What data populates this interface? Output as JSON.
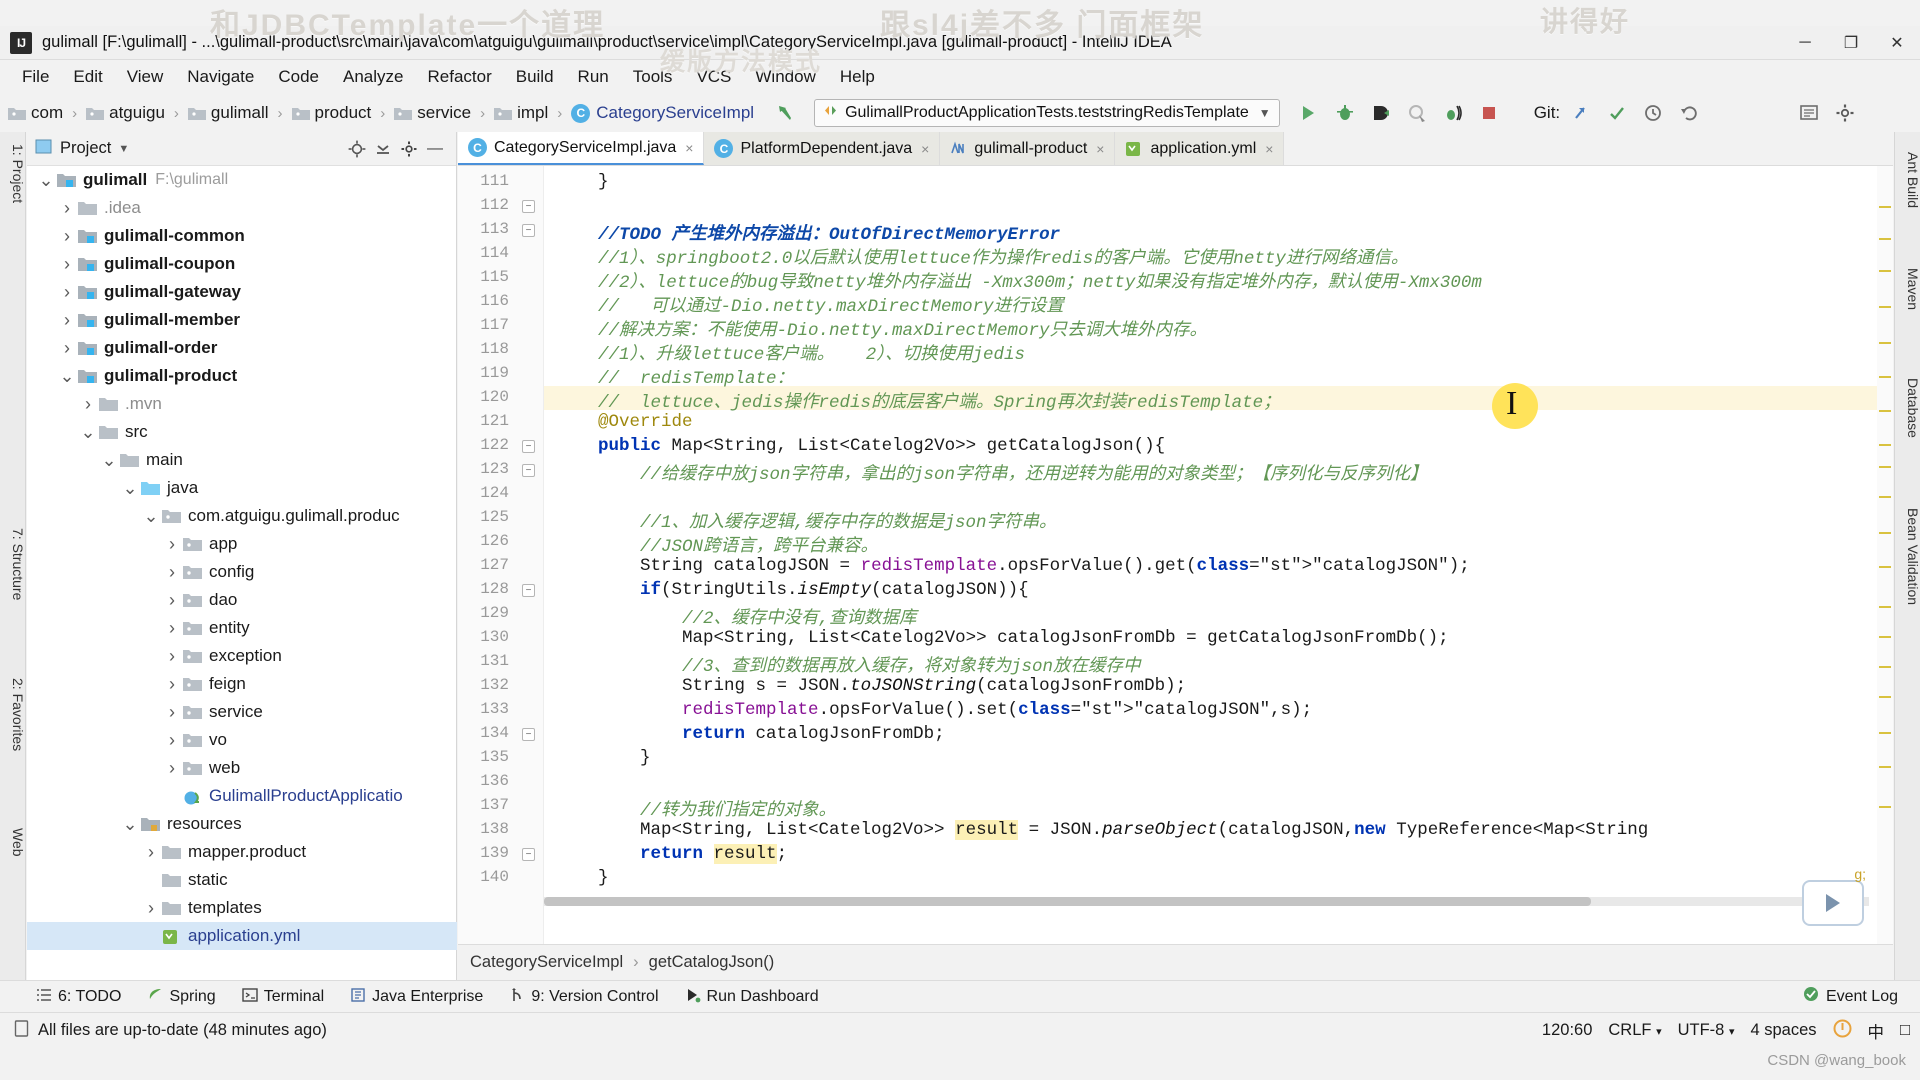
{
  "watermarks": [
    "和JDBCTemplate一个道理",
    "跟sl4j差不多  门面框架",
    "讲得好",
    "缓版方法模式"
  ],
  "window": {
    "logo": "IJ",
    "title": "gulimall [F:\\gulimall] - ...\\gulimall-product\\src\\main\\java\\com\\atguigu\\gulimall\\product\\service\\impl\\CategoryServiceImpl.java [gulimall-product] - IntelliJ IDEA",
    "minimize": "─",
    "maximize": "❐",
    "close": "✕"
  },
  "menubar": [
    "File",
    "Edit",
    "View",
    "Navigate",
    "Code",
    "Analyze",
    "Refactor",
    "Build",
    "Run",
    "Tools",
    "VCS",
    "Window",
    "Help"
  ],
  "breadcrumb": [
    {
      "label": "com",
      "icon": "folder-icon"
    },
    {
      "label": "atguigu",
      "icon": "folder-icon"
    },
    {
      "label": "gulimall",
      "icon": "folder-icon"
    },
    {
      "label": "product",
      "icon": "folder-icon"
    },
    {
      "label": "service",
      "icon": "folder-icon"
    },
    {
      "label": "impl",
      "icon": "folder-icon"
    },
    {
      "label": "CategoryServiceImpl",
      "icon": "class-icon"
    }
  ],
  "toolbar": {
    "back_icon": "back-arrow-icon",
    "run_config": "GulimallProductApplicationTests.teststringRedisTemplate",
    "dropdown_icon": "chevron-down-icon",
    "run_icon": "run-icon",
    "debug_icon": "debug-icon",
    "run_with_coverage_icon": "run-coverage-icon",
    "profile_icon": "profiler-icon",
    "stop_icon": "stop-icon",
    "git_label": "Git:",
    "git_update_icon": "update-project-icon",
    "git_commit_icon": "commit-icon",
    "git_history_icon": "history-icon",
    "git_rollback_icon": "rollback-icon",
    "search_everywhere_icon": "search-everywhere-icon",
    "settings_icon": "settings-icon"
  },
  "left_strip": [
    "1: Project",
    "7: Structure",
    "2: Favorites",
    "Web"
  ],
  "right_strip": [
    "Ant Build",
    "Maven",
    "Database",
    "Bean Validation"
  ],
  "project_panel": {
    "title": "Project",
    "panel_icon": "project-icon",
    "dropdown_icon": "chevron-down-icon",
    "locate_icon": "locate-icon",
    "collapse_icon": "collapse-all-icon",
    "settings_icon": "gear-icon",
    "hide_icon": "hide-icon",
    "tree": [
      {
        "label": "gulimall",
        "suffix": "F:\\gulimall",
        "indent": 0,
        "state": "open",
        "icon": "module-folder-icon",
        "bold": true
      },
      {
        "label": ".idea",
        "indent": 1,
        "state": "closed",
        "icon": "folder-icon",
        "dim": true
      },
      {
        "label": "gulimall-common",
        "indent": 1,
        "state": "closed",
        "icon": "module-folder-icon",
        "bold": true
      },
      {
        "label": "gulimall-coupon",
        "indent": 1,
        "state": "closed",
        "icon": "module-folder-icon",
        "bold": true
      },
      {
        "label": "gulimall-gateway",
        "indent": 1,
        "state": "closed",
        "icon": "module-folder-icon",
        "bold": true
      },
      {
        "label": "gulimall-member",
        "indent": 1,
        "state": "closed",
        "icon": "module-folder-icon",
        "bold": true
      },
      {
        "label": "gulimall-order",
        "indent": 1,
        "state": "closed",
        "icon": "module-folder-icon",
        "bold": true
      },
      {
        "label": "gulimall-product",
        "indent": 1,
        "state": "open",
        "icon": "module-folder-icon",
        "bold": true
      },
      {
        "label": ".mvn",
        "indent": 2,
        "state": "closed",
        "icon": "folder-icon",
        "dim": true
      },
      {
        "label": "src",
        "indent": 2,
        "state": "open",
        "icon": "folder-icon"
      },
      {
        "label": "main",
        "indent": 3,
        "state": "open",
        "icon": "folder-icon"
      },
      {
        "label": "java",
        "indent": 4,
        "state": "open",
        "icon": "source-folder-icon"
      },
      {
        "label": "com.atguigu.gulimall.produc",
        "indent": 5,
        "state": "open",
        "icon": "package-icon"
      },
      {
        "label": "app",
        "indent": 6,
        "state": "closed",
        "icon": "package-icon"
      },
      {
        "label": "config",
        "indent": 6,
        "state": "closed",
        "icon": "package-icon"
      },
      {
        "label": "dao",
        "indent": 6,
        "state": "closed",
        "icon": "package-icon"
      },
      {
        "label": "entity",
        "indent": 6,
        "state": "closed",
        "icon": "package-icon"
      },
      {
        "label": "exception",
        "indent": 6,
        "state": "closed",
        "icon": "package-icon"
      },
      {
        "label": "feign",
        "indent": 6,
        "state": "closed",
        "icon": "package-icon"
      },
      {
        "label": "service",
        "indent": 6,
        "state": "closed",
        "icon": "package-icon"
      },
      {
        "label": "vo",
        "indent": 6,
        "state": "closed",
        "icon": "package-icon"
      },
      {
        "label": "web",
        "indent": 6,
        "state": "closed",
        "icon": "package-icon"
      },
      {
        "label": "GulimallProductApplicatio",
        "indent": 6,
        "state": "leaf",
        "icon": "spring-class-icon",
        "blue": true
      },
      {
        "label": "resources",
        "indent": 4,
        "state": "open",
        "icon": "resources-folder-icon"
      },
      {
        "label": "mapper.product",
        "indent": 5,
        "state": "closed",
        "icon": "folder-icon"
      },
      {
        "label": "static",
        "indent": 5,
        "state": "leaf",
        "icon": "folder-icon"
      },
      {
        "label": "templates",
        "indent": 5,
        "state": "closed",
        "icon": "folder-icon"
      },
      {
        "label": "application.yml",
        "indent": 5,
        "state": "leaf",
        "icon": "yaml-icon",
        "blue": true,
        "selected": true
      }
    ]
  },
  "editor_tabs": [
    {
      "label": "CategoryServiceImpl.java",
      "icon": "class-icon",
      "active": true,
      "close": "×"
    },
    {
      "label": "PlatformDependent.java",
      "icon": "class-icon",
      "active": false,
      "close": "×"
    },
    {
      "label": "gulimall-product",
      "icon": "maven-icon",
      "active": false,
      "close": "×"
    },
    {
      "label": "application.yml",
      "icon": "yaml-icon",
      "active": false,
      "close": "×"
    }
  ],
  "code": {
    "first_line": 111,
    "line_numbers": [
      111,
      112,
      113,
      114,
      115,
      116,
      117,
      118,
      119,
      120,
      121,
      122,
      123,
      124,
      125,
      126,
      127,
      128,
      129,
      130,
      131,
      132,
      133,
      134,
      135,
      136,
      137,
      138,
      139,
      140
    ],
    "caret_line": 120,
    "lines": [
      "    }",
      "",
      "    //TODO 产生堆外内存溢出：OutOfDirectMemoryError",
      "    //1）、springboot2.0以后默认使用lettuce作为操作redis的客户端。它使用netty进行网络通信。",
      "    //2）、lettuce的bug导致netty堆外内存溢出 -Xmx300m；netty如果没有指定堆外内存，默认使用-Xmx300m",
      "    //   可以通过-Dio.netty.maxDirectMemory进行设置",
      "    //解决方案：不能使用-Dio.netty.maxDirectMemory只去调大堆外内存。",
      "    //1）、升级lettuce客户端。   2）、切换使用jedis",
      "    //  redisTemplate：",
      "    //  lettuce、jedis操作redis的底层客户端。Spring再次封装redisTemplate；",
      "    @Override",
      "    public Map<String, List<Catelog2Vo>> getCatalogJson(){",
      "        //给缓存中放json字符串，拿出的json字符串，还用逆转为能用的对象类型；【序列化与反序列化】",
      "",
      "        //1、加入缓存逻辑,缓存中存的数据是json字符串。",
      "        //JSON跨语言，跨平台兼容。",
      "        String catalogJSON = redisTemplate.opsForValue().get(\"catalogJSON\");",
      "        if(StringUtils.isEmpty(catalogJSON)){",
      "            //2、缓存中没有,查询数据库",
      "            Map<String, List<Catelog2Vo>> catalogJsonFromDb = getCatalogJsonFromDb();",
      "            //3、查到的数据再放入缓存，将对象转为json放在缓存中",
      "            String s = JSON.toJSONString(catalogJsonFromDb);",
      "            redisTemplate.opsForValue().set(\"catalogJSON\",s);",
      "            return catalogJsonFromDb;",
      "        }",
      "",
      "        //转为我们指定的对象。",
      "        Map<String, List<Catelog2Vo>> result = JSON.parseObject(catalogJSON,new TypeReference<Map<String",
      "        return result;",
      "    }"
    ]
  },
  "editor_breadcrumb": [
    "CategoryServiceImpl",
    "getCatalogJson()"
  ],
  "bottom_bar": [
    {
      "label": "6: TODO",
      "icon": "todo-icon"
    },
    {
      "label": "Spring",
      "icon": "spring-leaf-icon"
    },
    {
      "label": "Terminal",
      "icon": "terminal-icon"
    },
    {
      "label": "Java Enterprise",
      "icon": "java-ee-icon"
    },
    {
      "label": "9: Version Control",
      "icon": "vcs-branch-icon"
    },
    {
      "label": "Run Dashboard",
      "icon": "run-dashboard-icon"
    }
  ],
  "event_log": {
    "label": "Event Log",
    "icon": "event-log-icon"
  },
  "statusbar": {
    "message": "All files are up-to-date (48 minutes ago)",
    "message_icon": "file-sync-icon",
    "caret_position": "120:60",
    "line_separator": "CRLF",
    "encoding": "UTF-8",
    "indent": "4 spaces",
    "ime_icon": "ime-icon",
    "ime_lang": "中",
    "ime_extra": "□"
  },
  "credit": "CSDN @wang_book",
  "colors": {
    "accent_blue": "#4a90d9",
    "run_green": "#59a869",
    "comment_green": "#629755",
    "string_green": "#067d17",
    "keyword_blue": "#0033b3",
    "todo_blue": "#0d48a8",
    "caret_line": "#fdf6dd",
    "highlight_yellow": "#fcf0b6",
    "selection": "#d6e7f7"
  }
}
